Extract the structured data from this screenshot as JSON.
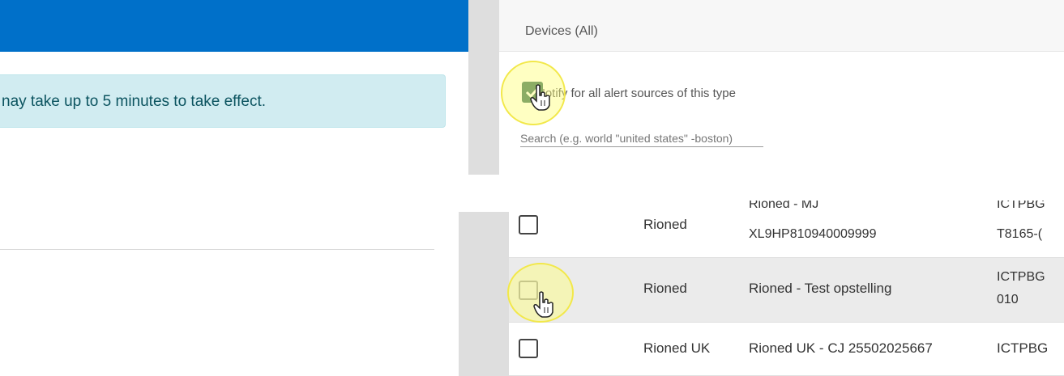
{
  "alert": {
    "message": "nay take up to 5 minutes to take effect."
  },
  "devices_panel": {
    "title": "Devices (All)",
    "notify_all_label": "Notify for all alert sources of this type",
    "notify_all_checked": true,
    "search_placeholder": "Search (e.g. world \"united states\" -boston)"
  },
  "table": {
    "rows": [
      {
        "checked": false,
        "owner": "Rioned",
        "name_line1": "Rioned - MJ",
        "name_line2": "XL9HP810940009999",
        "id_line1": "ICTPBG",
        "id_line2": "T8165-("
      },
      {
        "checked": false,
        "owner": "Rioned",
        "name_line1": "Rioned - Test opstelling",
        "name_line2": "",
        "id_line1": "ICTPBG",
        "id_line2": "010"
      },
      {
        "checked": false,
        "owner": "Rioned UK",
        "name_line1": "Rioned UK - CJ 25502025667",
        "name_line2": "",
        "id_line1": "ICTPBG",
        "id_line2": ""
      }
    ]
  },
  "icons": {
    "check": "check-icon",
    "cursor": "hand-pointer-icon",
    "highlight": "click-highlight"
  },
  "colors": {
    "header_blue": "#0070c9",
    "alert_bg": "#d1ecf1",
    "alert_text": "#0c5460",
    "checkbox_green": "#2e6b57",
    "highlight_yellow": "#ffff78"
  }
}
